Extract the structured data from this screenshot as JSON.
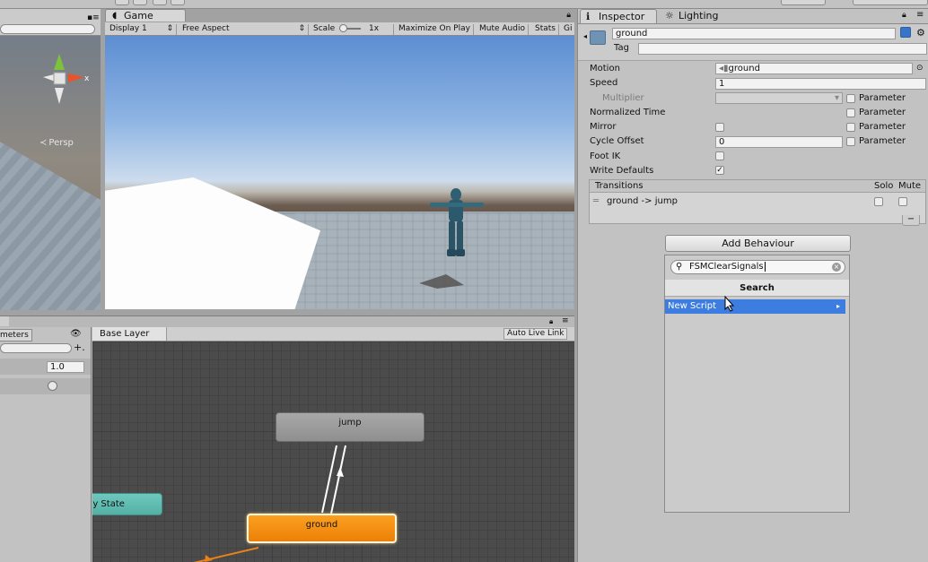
{
  "game": {
    "tab_label": "Game",
    "display": "Display 1",
    "aspect": "Free Aspect",
    "scale_label": "Scale",
    "scale_value": "1x",
    "maximize": "Maximize On Play",
    "mute_audio": "Mute Audio",
    "stats": "Stats",
    "gizmos": "Gi"
  },
  "scene": {
    "persp_label": "Persp"
  },
  "inspector": {
    "tab_label": "Inspector",
    "lighting_tab": "Lighting",
    "name_value": "ground",
    "tag_label": "Tag",
    "motion_label": "Motion",
    "motion_value": "ground",
    "speed_label": "Speed",
    "speed_value": "1",
    "multiplier_label": "Multiplier",
    "normalized_time_label": "Normalized Time",
    "mirror_label": "Mirror",
    "cycle_offset_label": "Cycle Offset",
    "cycle_offset_value": "0",
    "foot_ik_label": "Foot IK",
    "write_defaults_label": "Write Defaults",
    "write_defaults_checked": true,
    "parameter_label": "Parameter",
    "transitions": {
      "header": "Transitions",
      "solo": "Solo",
      "mute": "Mute",
      "items": [
        {
          "label": "ground -> jump"
        }
      ]
    },
    "add_behaviour": "Add Behaviour",
    "dropdown": {
      "search_value": "FSMClearSignals",
      "title": "Search",
      "items": [
        {
          "label": "New Script",
          "arrow": "▸"
        }
      ]
    }
  },
  "animator": {
    "params_tab": "meters",
    "param_value": "1.0",
    "layer_tab": "Base Layer",
    "auto_live_link": "Auto Live Link",
    "nodes": {
      "jump": "jump",
      "ground": "ground",
      "any_state": "ny State"
    }
  },
  "colors": {
    "accent_blue": "#3e7de0",
    "default_state_orange": "#f08c0c",
    "any_state_teal": "#5cb9b0",
    "state_gray": "#9a9a9a"
  }
}
